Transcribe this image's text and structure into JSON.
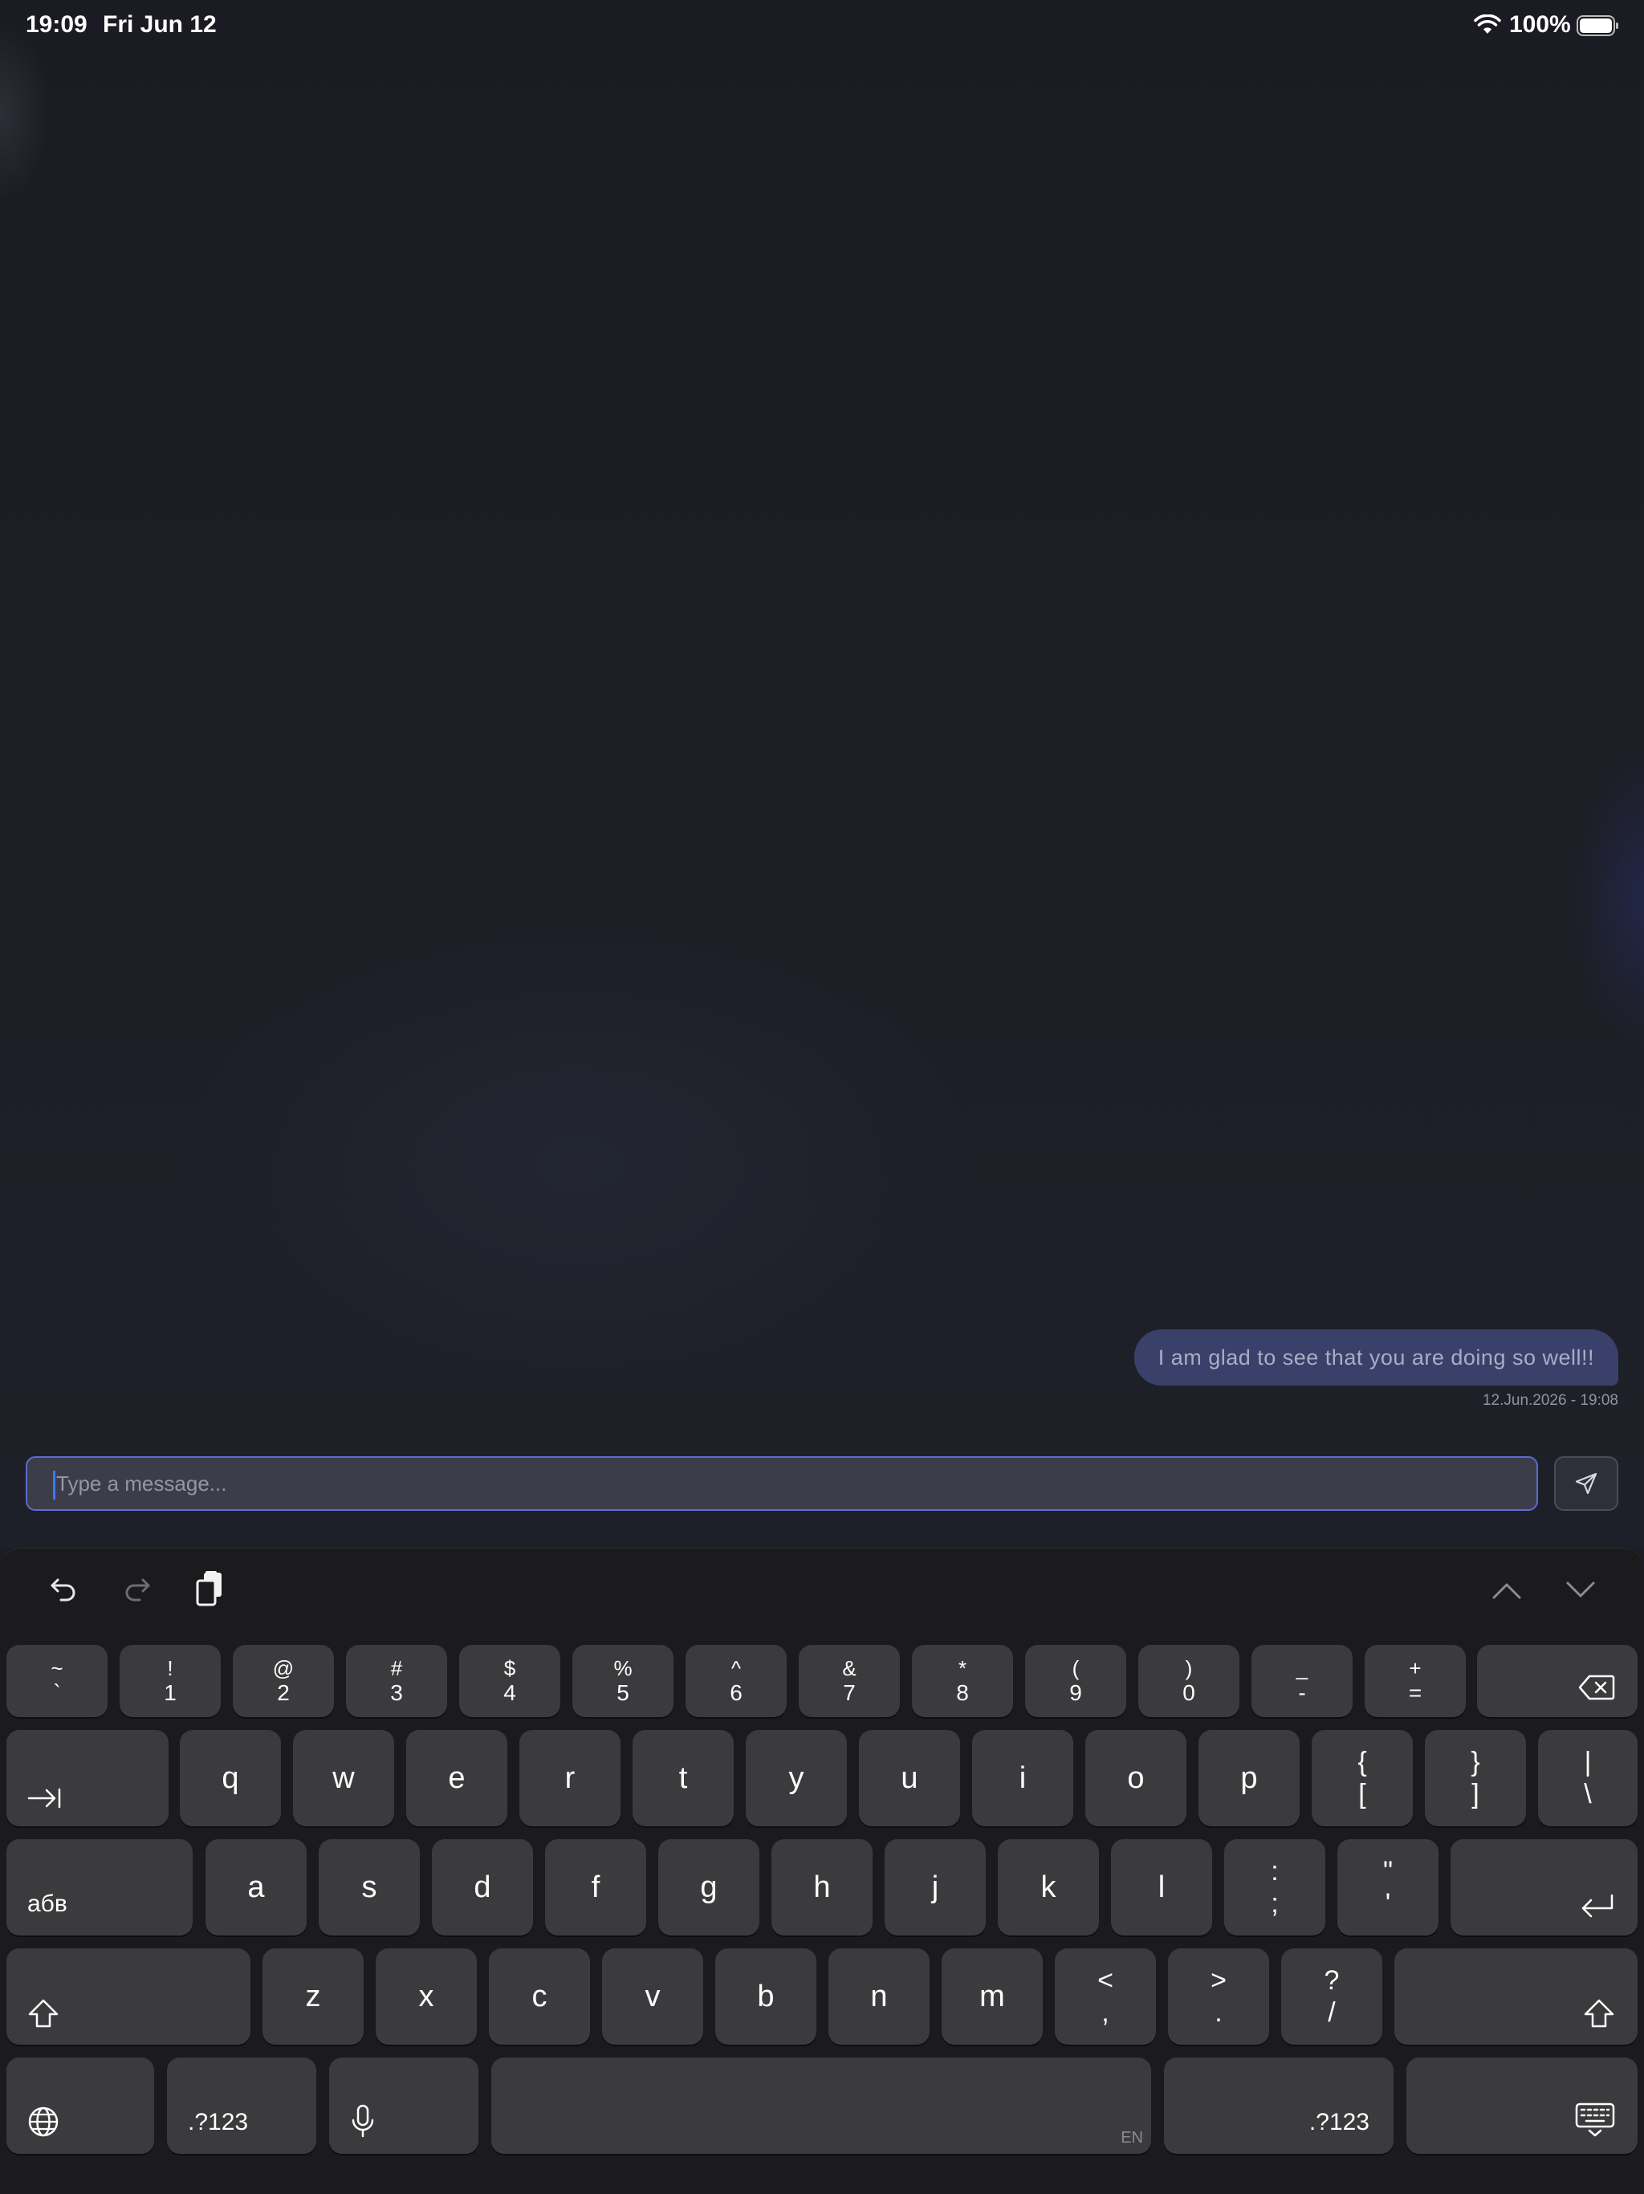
{
  "status_bar": {
    "time": "19:09",
    "date": "Fri Jun 12",
    "battery_percent": "100%",
    "icons": [
      "wifi-icon",
      "battery-icon"
    ]
  },
  "chat": {
    "messages": [
      {
        "text": "I am glad to see that you are doing so well!!",
        "timestamp": "12.Jun.2026 - 19:08",
        "outgoing": true
      }
    ]
  },
  "composer": {
    "placeholder": "Type a message...",
    "value": "",
    "send_icon": "send-icon"
  },
  "keyboard": {
    "toolbar_icons": [
      "undo-icon",
      "redo-icon",
      "clipboard-icon",
      "chevron-up-icon",
      "chevron-down-icon"
    ],
    "row1": [
      {
        "top": "~",
        "bot": "`"
      },
      {
        "top": "!",
        "bot": "1"
      },
      {
        "top": "@",
        "bot": "2"
      },
      {
        "top": "#",
        "bot": "3"
      },
      {
        "top": "$",
        "bot": "4"
      },
      {
        "top": "%",
        "bot": "5"
      },
      {
        "top": "^",
        "bot": "6"
      },
      {
        "top": "&",
        "bot": "7"
      },
      {
        "top": "*",
        "bot": "8"
      },
      {
        "top": "(",
        "bot": "9"
      },
      {
        "top": ")",
        "bot": "0"
      },
      {
        "top": "_",
        "bot": "-"
      },
      {
        "top": "+",
        "bot": "="
      }
    ],
    "row2": [
      "q",
      "w",
      "e",
      "r",
      "t",
      "y",
      "u",
      "i",
      "o",
      "p"
    ],
    "row2_sym": [
      {
        "top": "{",
        "bot": "["
      },
      {
        "top": "}",
        "bot": "]"
      },
      {
        "top": "|",
        "bot": "\\"
      }
    ],
    "row3": [
      "a",
      "s",
      "d",
      "f",
      "g",
      "h",
      "j",
      "k",
      "l"
    ],
    "row3_sym": [
      {
        "top": ":",
        "bot": ";"
      },
      {
        "top": "\"",
        "bot": "'"
      }
    ],
    "lang_key": "абв",
    "row4": [
      "z",
      "x",
      "c",
      "v",
      "b",
      "n",
      "m"
    ],
    "row4_sym": [
      {
        "top": "<",
        "bot": ","
      },
      {
        "top": ">",
        "bot": "."
      },
      {
        "top": "?",
        "bot": "/"
      }
    ],
    "symbols_key": ".?123",
    "space_lang": "EN",
    "accent_color": "#5b6bd3"
  }
}
